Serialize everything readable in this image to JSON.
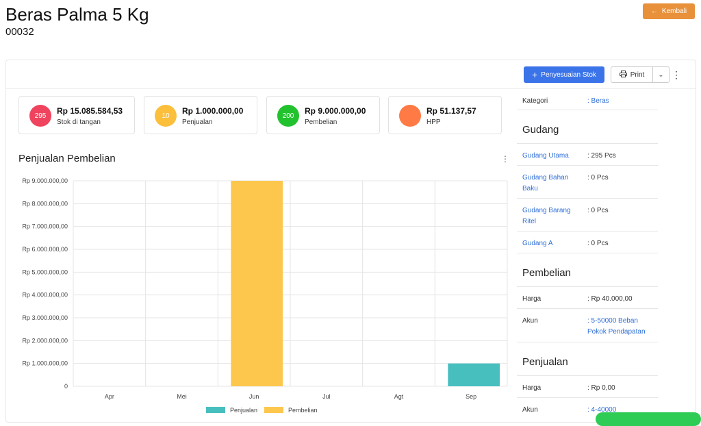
{
  "header": {
    "title": "Beras Palma 5 Kg",
    "code": "00032",
    "back_label": "Kembali",
    "back_icon": "arrow-left-icon"
  },
  "toolbar": {
    "adjust_label": "Penyesuaian Stok",
    "print_label": "Print"
  },
  "stats": [
    {
      "badge": "295",
      "value": "Rp 15.085.584,53",
      "label": "Stok di tangan",
      "color": "#f0445e"
    },
    {
      "badge": "10",
      "value": "Rp 1.000.000,00",
      "label": "Penjualan",
      "color": "#fbbf3c"
    },
    {
      "badge": "200",
      "value": "Rp 9.000.000,00",
      "label": "Pembelian",
      "color": "#22c22f"
    },
    {
      "badge": "",
      "value": "Rp 51.137,57",
      "label": "HPP",
      "color": "#ff7a45"
    }
  ],
  "chart": {
    "title": "Penjualan Pembelian"
  },
  "chart_data": {
    "type": "bar",
    "categories": [
      "Apr",
      "Mei",
      "Jun",
      "Jul",
      "Agt",
      "Sep"
    ],
    "series": [
      {
        "name": "Penjualan",
        "color": "#48bfbf",
        "values": [
          0,
          0,
          0,
          0,
          0,
          1000000
        ]
      },
      {
        "name": "Pembelian",
        "color": "#fdc74e",
        "values": [
          0,
          0,
          9000000,
          0,
          0,
          0
        ]
      }
    ],
    "yticks": [
      "0",
      "Rp 1.000.000,00",
      "Rp 2.000.000,00",
      "Rp 3.000.000,00",
      "Rp 4.000.000,00",
      "Rp 5.000.000,00",
      "Rp 6.000.000,00",
      "Rp 7.000.000,00",
      "Rp 8.000.000,00",
      "Rp 9.000.000,00"
    ],
    "ylim": [
      0,
      9000000
    ],
    "grid": true,
    "legend": "bottom"
  },
  "info": {
    "kategori_label": "Kategori",
    "kategori_value": ": Beras",
    "gudang_title": "Gudang",
    "gudang": [
      {
        "name": "Gudang Utama",
        "value": ": 295 Pcs"
      },
      {
        "name": "Gudang Bahan Baku",
        "value": ": 0 Pcs"
      },
      {
        "name": "Gudang Barang Ritel",
        "value": ": 0 Pcs"
      },
      {
        "name": "Gudang A",
        "value": ": 0 Pcs"
      }
    ],
    "pembelian_title": "Pembelian",
    "pembelian_harga_label": "Harga",
    "pembelian_harga": ": Rp 40.000,00",
    "pembelian_akun_label": "Akun",
    "pembelian_akun": ": 5-50000 Beban Pokok Pendapatan",
    "penjualan_title": "Penjualan",
    "penjualan_harga_label": "Harga",
    "penjualan_harga": ": Rp 0,00",
    "penjualan_akun_label": "Akun",
    "penjualan_akun": ": 4-40000"
  }
}
